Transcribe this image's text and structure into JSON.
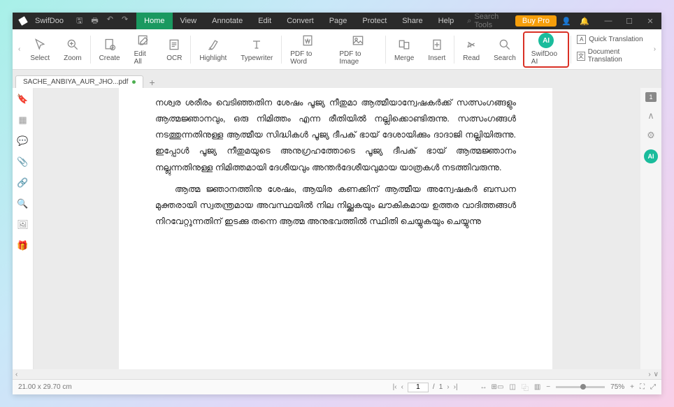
{
  "app": {
    "name": "SwifDoo"
  },
  "titlebar": {
    "searchTools": "Search Tools",
    "buyPro": "Buy Pro"
  },
  "menu": [
    "Home",
    "View",
    "Annotate",
    "Edit",
    "Convert",
    "Page",
    "Protect",
    "Share",
    "Help"
  ],
  "ribbon": {
    "select": "Select",
    "zoom": "Zoom",
    "create": "Create",
    "editAll": "Edit All",
    "ocr": "OCR",
    "highlight": "Highlight",
    "typewriter": "Typewriter",
    "pdfToWord": "PDF to Word",
    "pdfToImage": "PDF to Image",
    "merge": "Merge",
    "insert": "Insert",
    "read": "Read",
    "search": "Search",
    "swifdooAi": "SwifDoo AI",
    "quickTrans": "Quick Translation",
    "docTrans": "Document Translation"
  },
  "tab": {
    "name": "SACHE_ANBIYA_AUR_JHO...pdf"
  },
  "document": {
    "para1": "നശ്വര   ശരീരം   വെടിഞ്ഞതിന   ശേഷം   പൂജ്യ   നീതുമാ   ആത്മീയാന്വേഷകർക്ക്   സത്സംഗങ്ങളും   ആത്മജ്ഞാനവും,   ഒരു   നിമിത്തം  എന്ന  രീതിയിൽ  നല്ലിക്കൊണ്ടിരുന്നു.      സത്സംഗങ്ങൾ   നടത്തുന്നതിനുള്ള  ആത്മീയ  സിദ്ധികൾ  പൂജ്യ  ദീപക്  ഭായ്   ദേശായിക്കും  ദാദാജി  നല്ലിയിരുന്നു.    ഇപ്പോൾ  പൂജ്യ  നീതുമയുടെ   അനുഗ്രഹത്തോടെ    പൂജ്യ    ദീപക്    ഭായ്    ആത്മജ്ഞാനം   നല്ലുന്നതിനുള്ള  നിമിത്തമായി  ദേശീയവും  അന്തർദേശീയവുമായ   യാത്രകൾ  നടത്തിവരുന്നു.",
    "para2": "ആത്മ  ജ്ഞാനത്തിനു  ശേഷം,  ആയിര  കണക്കിന്  ആത്മീയ   അന്വേഷകർ  ബന്ധന  മുക്തരായി  സ്വതന്ത്രമായ  അവസ്ഥയിൽ  നില   നില്ക്കുകയും  ലൗകികമായ  ഉത്തര  വാദിത്തങ്ങൾ  നിറവേറ്റുന്നതിന്   ഇടക്കു  തന്നെ  ആത്മ  അനുഭവത്തിൽ  സ്ഥിതി  ചെയ്യുകയും  ചെയ്യുന്നു"
  },
  "sidebarR": {
    "pageNum": "1"
  },
  "status": {
    "dims": "21.00 x 29.70 cm",
    "page": "1",
    "pageTotal": "1",
    "zoom": "75%"
  }
}
